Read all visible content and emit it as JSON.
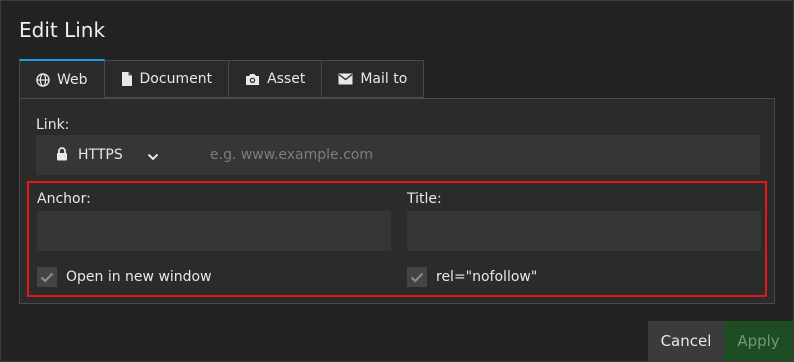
{
  "dialog": {
    "title": "Edit Link"
  },
  "tabs": [
    {
      "label": "Web",
      "icon": "globe-icon",
      "active": true
    },
    {
      "label": "Document",
      "icon": "document-icon",
      "active": false
    },
    {
      "label": "Asset",
      "icon": "camera-icon",
      "active": false
    },
    {
      "label": "Mail to",
      "icon": "envelope-icon",
      "active": false
    }
  ],
  "link": {
    "label": "Link:",
    "protocol": "HTTPS",
    "placeholder": "e.g. www.example.com",
    "value": ""
  },
  "anchor": {
    "label": "Anchor:",
    "value": ""
  },
  "title_field": {
    "label": "Title:",
    "value": ""
  },
  "open_new_window": {
    "label": "Open in new window",
    "checked": true
  },
  "nofollow": {
    "label": "rel=\"nofollow\"",
    "checked": true
  },
  "buttons": {
    "cancel": "Cancel",
    "apply": "Apply"
  },
  "colors": {
    "accent": "#1e9be6",
    "highlight_border": "#e4161a",
    "apply_bg": "#1e4d24"
  }
}
